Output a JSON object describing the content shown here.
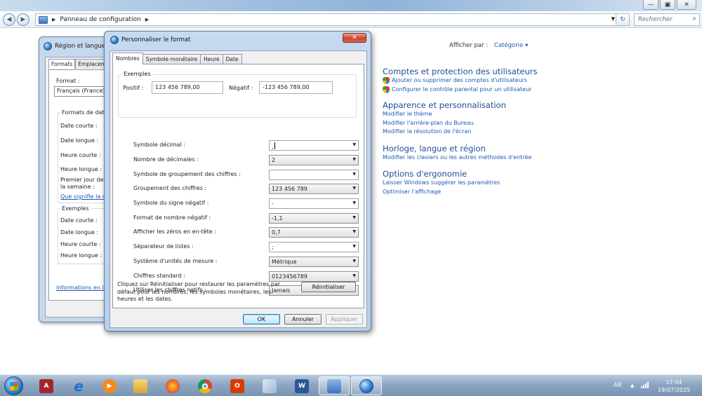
{
  "explorer": {
    "breadcrumb": "Panneau de configuration",
    "search_placeholder": "Rechercher",
    "window_buttons": {
      "minimize": "—",
      "maximize": "▣",
      "close": "✕"
    }
  },
  "control_panel": {
    "view_by_label": "Afficher par :",
    "view_by_value": "Catégorie",
    "categories": [
      {
        "title": "Comptes et protection des utilisateurs",
        "links": [
          "Ajouter ou supprimer des comptes d'utilisateurs",
          "Configurer le contrôle parental pour un utilisateur"
        ]
      },
      {
        "title": "Apparence et personnalisation",
        "links": [
          "Modifier le thème",
          "Modifier l'arrière-plan du Bureau",
          "Modifier la résolution de l'écran"
        ]
      },
      {
        "title": "Horloge, langue et région",
        "links": [
          "Modifier les claviers ou les autres méthodes d'entrée"
        ]
      },
      {
        "title": "Options d'ergonomie",
        "links": [
          "Laisser Windows suggérer les paramètres",
          "Optimiser l'affichage"
        ]
      }
    ]
  },
  "region_window": {
    "title": "Région et langue",
    "tabs": [
      "Formats",
      "Emplacement"
    ],
    "format_label": "Format :",
    "format_value": "Français (France)",
    "date_formats_heading": "Formats de date",
    "labels": [
      "Date courte :",
      "Date longue :",
      "Heure courte :",
      "Heure longue :",
      "Premier jour de la semaine :"
    ],
    "link_meaning": "Que signifie la no",
    "examples_heading": "Exemples",
    "example_labels": [
      "Date courte :",
      "Date longue :",
      "Heure courte :",
      "Heure longue :"
    ],
    "link_online": "Informations en lig"
  },
  "dialog": {
    "title": "Personnaliser le format",
    "close": "✕",
    "tabs": [
      "Nombres",
      "Symbole monétaire",
      "Heure",
      "Date"
    ],
    "examples": {
      "legend": "Exemples",
      "positive_label": "Positif :",
      "positive_value": "123 456 789,00",
      "negative_label": "Négatif :",
      "negative_value": "-123 456 789,00"
    },
    "rows": [
      {
        "label": "Symbole décimal :",
        "value": ","
      },
      {
        "label": "Nombre de décimales :",
        "value": "2"
      },
      {
        "label": "Symbole de groupement des chiffres :",
        "value": ""
      },
      {
        "label": "Groupement des chiffres :",
        "value": "123 456 789"
      },
      {
        "label": "Symbole du signe négatif :",
        "value": "-"
      },
      {
        "label": "Format de nombre négatif :",
        "value": "-1,1"
      },
      {
        "label": "Afficher les zéros en en-tête :",
        "value": "0,7"
      },
      {
        "label": "Séparateur de listes :",
        "value": ";"
      },
      {
        "label": "Système d'unités de mesure :",
        "value": "Métrique"
      },
      {
        "label": "Chiffres standard :",
        "value": "0123456789"
      },
      {
        "label": "Utiliser les chiffres natifs :",
        "value": "Jamais"
      }
    ],
    "note": "Cliquez sur Réinitialiser pour restaurer les paramètres par défaut pour les nombres, les symboles monétaires, les heures et les dates.",
    "reset": "Réinitialiser",
    "ok": "OK",
    "cancel": "Annuler",
    "apply": "Appliquer"
  },
  "taskbar": {
    "language": "AR",
    "time": "17:04",
    "date": "19/07/2025"
  }
}
